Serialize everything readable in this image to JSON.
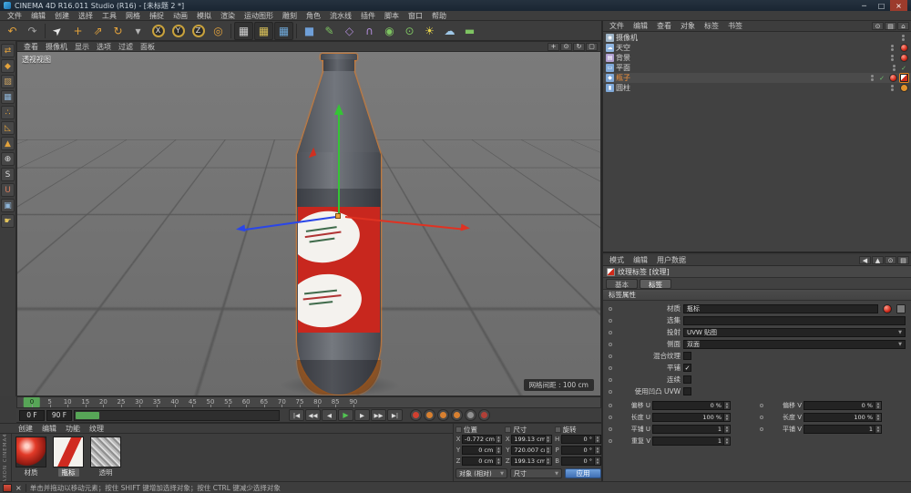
{
  "window": {
    "title": "CINEMA 4D R16.011 Studio (R16) - [未标题 2 *]",
    "controls": {
      "minimize": "─",
      "maximize": "□",
      "close": "×"
    }
  },
  "menubar": {
    "items": [
      "文件",
      "编辑",
      "创建",
      "选择",
      "工具",
      "网格",
      "捕捉",
      "动画",
      "模拟",
      "渲染",
      "运动图形",
      "雕刻",
      "角色",
      "流水线",
      "插件",
      "脚本",
      "窗口",
      "帮助"
    ]
  },
  "toolbar": {
    "icons": [
      {
        "name": "undo",
        "glyph": "↶",
        "color": "#e2a23c"
      },
      {
        "name": "redo",
        "glyph": "↷",
        "color": "#9f9f9f"
      },
      {
        "name": "live-selection",
        "glyph": "➤",
        "color": "#e8e8e8",
        "cursor": true
      },
      {
        "name": "move-tool",
        "glyph": "+",
        "color": "#e2a23c"
      },
      {
        "name": "scale-tool",
        "glyph": "⇗",
        "color": "#e2a23c"
      },
      {
        "name": "rotate-tool",
        "glyph": "↻",
        "color": "#e2a23c"
      },
      {
        "name": "last-tool",
        "glyph": "▾",
        "color": "#b5b5b5"
      },
      {
        "name": "lock-x",
        "glyph": "X",
        "ring": true
      },
      {
        "name": "lock-y",
        "glyph": "Y",
        "ring": true
      },
      {
        "name": "lock-z",
        "glyph": "Z",
        "ring": true
      },
      {
        "name": "coord-system",
        "glyph": "◎",
        "color": "#e2a23c"
      },
      {
        "name": "render-view",
        "glyph": "▦",
        "color": "#cfcfcf",
        "dark": true
      },
      {
        "name": "render-picture-viewer",
        "glyph": "▦",
        "color": "#d8c05a",
        "dark": true
      },
      {
        "name": "render-settings",
        "glyph": "▦",
        "color": "#6fa8d8",
        "dark": true
      },
      {
        "name": "add-cube",
        "glyph": "■",
        "color": "#6f9fd8"
      },
      {
        "name": "spline-pen",
        "glyph": "✎",
        "color": "#7ec462"
      },
      {
        "name": "add-subdivision",
        "glyph": "◇",
        "color": "#b08cd8"
      },
      {
        "name": "add-bend",
        "glyph": "∩",
        "color": "#b08cd8"
      },
      {
        "name": "add-instance",
        "glyph": "◉",
        "color": "#7ec462"
      },
      {
        "name": "add-camera",
        "glyph": "⊙",
        "color": "#7ec462"
      },
      {
        "name": "add-light",
        "glyph": "☀",
        "color": "#e8d44c"
      },
      {
        "name": "add-sky",
        "glyph": "☁",
        "color": "#9fc8e8"
      },
      {
        "name": "add-floor",
        "glyph": "▬",
        "color": "#7ec462"
      }
    ]
  },
  "left_toolbar": {
    "icons": [
      {
        "name": "convert-selection",
        "glyph": "⇄",
        "color": "#e2a23c"
      },
      {
        "name": "model-mode",
        "glyph": "◆",
        "color": "#e2a23c"
      },
      {
        "name": "texture-mode",
        "glyph": "▨",
        "color": "#c8a060"
      },
      {
        "name": "workplane-mode",
        "glyph": "▦",
        "color": "#8fb5d8"
      },
      {
        "name": "points-mode",
        "glyph": "∴",
        "color": "#e2a23c"
      },
      {
        "name": "edges-mode",
        "glyph": "◺",
        "color": "#e2a23c"
      },
      {
        "name": "polygons-mode",
        "glyph": "▲",
        "color": "#e2a23c"
      },
      {
        "name": "enable-axis",
        "glyph": "⊕",
        "color": "#d8d8d8"
      },
      {
        "name": "viewport-solo",
        "glyph": "S",
        "color": "#d8d8d8"
      },
      {
        "name": "enable-snap",
        "glyph": "U",
        "color": "#d87c5c"
      },
      {
        "name": "locked-workplane",
        "glyph": "▣",
        "color": "#8fb5d8"
      },
      {
        "name": "quantize",
        "glyph": "☛",
        "color": "#e2c45c"
      }
    ]
  },
  "viewport": {
    "menu": [
      "查看",
      "摄像机",
      "显示",
      "选项",
      "过滤",
      "面板"
    ],
    "corner_icons": [
      {
        "name": "pan-view",
        "glyph": "+"
      },
      {
        "name": "zoom-view",
        "glyph": "⊙"
      },
      {
        "name": "rotate-view",
        "glyph": "↻"
      },
      {
        "name": "toggle-view",
        "glyph": "▢"
      }
    ],
    "view_label": "透视视图",
    "grid_info": "网格间距 : 100 cm"
  },
  "timeline": {
    "ticks": [
      0,
      5,
      10,
      15,
      20,
      25,
      30,
      35,
      40,
      45,
      50,
      55,
      60,
      65,
      70,
      75,
      80,
      85,
      90
    ],
    "current_frame": "0 F",
    "end_frame": "90 F",
    "transport": [
      {
        "name": "goto-start",
        "glyph": "|◀"
      },
      {
        "name": "prev-key",
        "glyph": "◀◀"
      },
      {
        "name": "prev-frame",
        "glyph": "◀"
      },
      {
        "name": "play",
        "glyph": "▶",
        "color": "#52c452"
      },
      {
        "name": "next-frame",
        "glyph": "▶"
      },
      {
        "name": "next-key",
        "glyph": "▶▶"
      },
      {
        "name": "goto-end",
        "glyph": "▶|"
      }
    ],
    "record_buttons": [
      {
        "name": "record-keyframe",
        "color": "#d04030"
      },
      {
        "name": "key-position",
        "color": "#d88030"
      },
      {
        "name": "key-scale",
        "color": "#d88030"
      },
      {
        "name": "key-rotation",
        "color": "#d88030"
      },
      {
        "name": "key-parameter",
        "color": "#909090"
      },
      {
        "name": "autokey",
        "color": "#b04038"
      }
    ]
  },
  "materials": {
    "menu": [
      "创建",
      "编辑",
      "功能",
      "纹理"
    ],
    "brand": "MAXON CINEMA4D",
    "items": [
      {
        "name": "材质",
        "kind": "red-sphere"
      },
      {
        "name": "瓶标",
        "kind": "label",
        "selected": true
      },
      {
        "name": "透明",
        "kind": "noise"
      }
    ]
  },
  "coordinates": {
    "groups": [
      {
        "key": "position",
        "title": "位置",
        "axis": [
          "X",
          "Y",
          "Z"
        ],
        "values": [
          "-0.772 cm",
          "0 cm",
          "0 cm"
        ]
      },
      {
        "key": "size",
        "title": "尺寸",
        "axis": [
          "X",
          "Y",
          "Z"
        ],
        "values": [
          "199.13 cm",
          "720.007 cm",
          "199.13 cm"
        ]
      },
      {
        "key": "rotation",
        "title": "旋转",
        "axis": [
          "H",
          "P",
          "B"
        ],
        "values": [
          "0 °",
          "0 °",
          "0 °"
        ]
      }
    ],
    "mode_object": "对象 (相对)",
    "mode_size": "尺寸",
    "apply_label": "应用"
  },
  "object_manager": {
    "menu": [
      "文件",
      "编辑",
      "查看",
      "对象",
      "标签",
      "书签"
    ],
    "corner_icons": [
      {
        "name": "om-search",
        "glyph": "⊙"
      },
      {
        "name": "om-filter",
        "glyph": "▤"
      },
      {
        "name": "om-path",
        "glyph": "⌂"
      }
    ],
    "objects": [
      {
        "key": "camera",
        "name": "摄像机",
        "glyph": "◉",
        "iconColor": "#9fb5c8",
        "tags": [
          "dots"
        ]
      },
      {
        "key": "sky",
        "name": "天空",
        "glyph": "☁",
        "iconColor": "#8fb5e0",
        "tags": [
          "dots",
          "mat-red"
        ]
      },
      {
        "key": "background",
        "name": "背景",
        "glyph": "▤",
        "iconColor": "#b09fd0",
        "tags": [
          "dots",
          "mat-red"
        ]
      },
      {
        "key": "plane",
        "name": "平面",
        "glyph": "▭",
        "iconColor": "#7fa8d8",
        "tags": [
          "dots",
          "check"
        ]
      },
      {
        "key": "bottle",
        "name": "瓶子",
        "glyph": "◆",
        "iconColor": "#7fa8d8",
        "selected": true,
        "tags": [
          "dots",
          "check",
          "mat-red",
          "tex-active"
        ]
      },
      {
        "key": "cylinder",
        "name": "圆柱",
        "glyph": "▮",
        "iconColor": "#7fa8d8",
        "tags": [
          "dots",
          "tag-orange"
        ]
      }
    ]
  },
  "attributes": {
    "menu": [
      "模式",
      "编辑",
      "用户数据"
    ],
    "corner_icons": [
      {
        "name": "am-back",
        "glyph": "◀"
      },
      {
        "name": "am-up",
        "glyph": "▲"
      },
      {
        "name": "am-lock",
        "glyph": "⊙"
      },
      {
        "name": "am-panel",
        "glyph": "▤"
      }
    ],
    "title": "纹理标签 [纹理]",
    "tabs": [
      {
        "label": "基本",
        "active": false
      },
      {
        "label": "标签",
        "active": true
      }
    ],
    "section": "标签属性",
    "rows": [
      {
        "label": "材质",
        "type": "link",
        "value": "瓶标"
      },
      {
        "label": "选集",
        "type": "text",
        "value": ""
      },
      {
        "label": "投射",
        "type": "select",
        "value": "UVW 贴图"
      },
      {
        "label": "侧面",
        "type": "select",
        "value": "双面"
      },
      {
        "label": "混合纹理",
        "type": "check",
        "checked": false
      },
      {
        "label": "平铺",
        "type": "check",
        "checked": true
      },
      {
        "label": "连续",
        "type": "check",
        "checked": false
      },
      {
        "label": "使用凹凸 UVW",
        "type": "check",
        "checked": false
      }
    ],
    "uv_rows": [
      [
        {
          "label": "偏移 U",
          "value": "0 %"
        },
        {
          "label": "偏移 V",
          "value": "0 %"
        }
      ],
      [
        {
          "label": "长度 U",
          "value": "100 %"
        },
        {
          "label": "长度 V",
          "value": "100 %"
        }
      ],
      [
        {
          "label": "平铺 U",
          "value": "1"
        },
        {
          "label": "平铺 V",
          "value": "1"
        }
      ],
      [
        {
          "label": "重复 V",
          "value": "1"
        },
        null
      ]
    ]
  },
  "scene": {
    "axis_colors": {
      "x": "#e03222",
      "y": "#35c435",
      "z": "#2a46e8"
    },
    "label_red": "#c8271e"
  },
  "statusbar": {
    "text": "单击并拖动以移动元素；按住 SHIFT 键增加选择对象；按住 CTRL 键减少选择对象"
  }
}
